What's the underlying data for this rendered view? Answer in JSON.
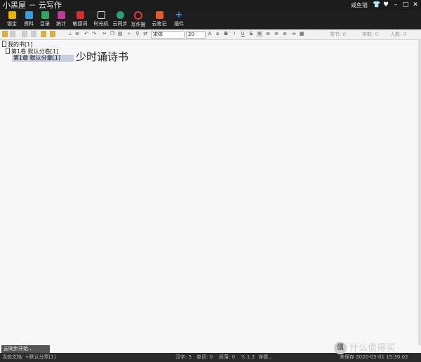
{
  "window": {
    "title": "小黑屋 － 云写作",
    "user": "咸鱼猫",
    "controls": [
      "👕",
      "♥",
      "–",
      "□",
      "✕"
    ]
  },
  "ribbon": [
    {
      "label": "锁定",
      "icon": "lock-icon",
      "color": "#e8b400"
    },
    {
      "label": "资料",
      "icon": "document-icon",
      "color": "#3a9de0"
    },
    {
      "label": "目录",
      "icon": "catalog-icon",
      "color": "#2fa85c"
    },
    {
      "label": "统计",
      "icon": "statistics-icon",
      "color": "#c0399c"
    },
    {
      "label": "敏感词",
      "icon": "sensitive-words-icon",
      "color": "#d62e2e"
    },
    {
      "label": "时光机",
      "icon": "time-machine-icon",
      "color": "#e0e0e0"
    },
    {
      "label": "云同步",
      "icon": "cloud-sync-icon",
      "color": "#22a37a"
    },
    {
      "label": "写作圈",
      "icon": "writing-circle-icon",
      "color": "#e53935"
    },
    {
      "label": "云笔记",
      "icon": "cloud-note-icon",
      "color": "#e65a2a"
    },
    {
      "label": "插件",
      "icon": "plus-icon",
      "color": "#2f8fe0"
    }
  ],
  "toolbar": {
    "font_family": "宋体",
    "font_size": "20",
    "stats": {
      "chapters": "章节: 0",
      "words": "字数: 0",
      "people": "人数: 0"
    }
  },
  "tree": {
    "book": "我的书[1]",
    "volume": "第1卷 默认分卷[1]",
    "chapter": "第1章 默认分章[1]"
  },
  "editor": {
    "title": "少时诵诗书"
  },
  "message": "云同步开始...",
  "statusbar": {
    "current_doc": "当前文档: +默认分章[1]",
    "hanzi": "汉字: 5",
    "words": "单词: 0",
    "paragraphs": "段落: 0",
    "position": "Y: 1.2",
    "details": "详情...",
    "saved": "未保存 2020-03-01 15:30:02"
  },
  "watermark": {
    "logo_text": "值",
    "text": "什么值得买"
  }
}
